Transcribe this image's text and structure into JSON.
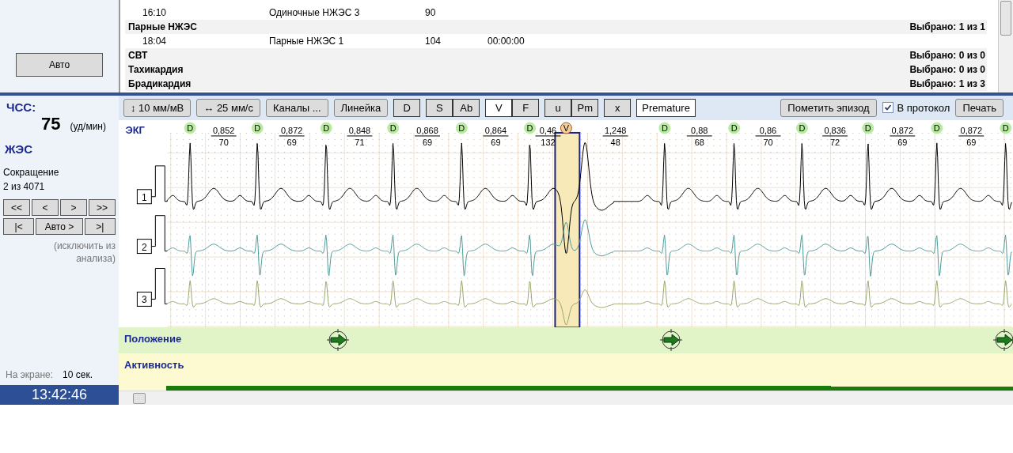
{
  "event_list": {
    "rows": [
      {
        "kind": "event",
        "time": "16:10",
        "name": "Одиночные НЖЭС 3",
        "value": "90"
      },
      {
        "kind": "group",
        "name": "Парные НЖЭС",
        "summary": "Выбрано: 1 из 1"
      },
      {
        "kind": "event",
        "time": "18:04",
        "name": "Парные НЖЭС 1",
        "value": "104",
        "duration": "00:00:00"
      },
      {
        "kind": "group",
        "name": "СВТ",
        "summary": "Выбрано: 0 из 0"
      },
      {
        "kind": "group",
        "name": "Тахикардия",
        "summary": "Выбрано: 0 из 0"
      },
      {
        "kind": "group",
        "name": "Брадикардия",
        "summary": "Выбрано: 1 из 3"
      }
    ]
  },
  "auto_button": "Авто",
  "side_panel": {
    "hr_label": "ЧСС:",
    "hr_value": "75",
    "hr_unit": "(уд/мин)",
    "beat_class": "ЖЭС",
    "beat_label": "Сокращение",
    "beat_position": "2 из 4071",
    "nav_rows": [
      [
        "<<",
        "<",
        ">",
        ">>"
      ],
      [
        "|<",
        "Авто >",
        ">|"
      ]
    ],
    "exclude_note": "(исключить из анализа)",
    "screen_label": "На экране:",
    "screen_value": "10 сек.",
    "clock": "13:42:46"
  },
  "toolbar": {
    "left_buttons": [
      "↕ 10 мм/мВ",
      "↔ 25 мм/с",
      "Каналы ...",
      "Линейка"
    ],
    "toggle_groups": [
      [
        {
          "label": "D",
          "selected": false
        }
      ],
      [
        {
          "label": "S",
          "selected": false
        },
        {
          "label": "Ab",
          "selected": false
        }
      ],
      [
        {
          "label": "V",
          "selected": true
        },
        {
          "label": "F",
          "selected": false
        }
      ],
      [
        {
          "label": "u",
          "selected": false
        },
        {
          "label": "Pm",
          "selected": false
        }
      ],
      [
        {
          "label": "x",
          "selected": false
        }
      ],
      [
        {
          "label": "Premature",
          "selected": true
        }
      ]
    ],
    "mark_button": "Пометить эпизод",
    "protocol": {
      "label": "В протокол",
      "checked": true
    },
    "print_button": "Печать"
  },
  "ecg": {
    "label": "ЭКГ",
    "channels": [
      {
        "number": "1",
        "color": "#000000"
      },
      {
        "number": "2",
        "color": "#4f9c9c"
      },
      {
        "number": "3",
        "color": "#98a86c"
      }
    ],
    "beats": [
      {
        "kind": "normal",
        "label": "D",
        "selected": false
      },
      {
        "kind": "normal",
        "label": "D",
        "rr": "0,852",
        "hr": "70",
        "selected": false
      },
      {
        "kind": "normal",
        "label": "D",
        "rr": "0,872",
        "hr": "69",
        "selected": false
      },
      {
        "kind": "normal",
        "label": "D",
        "rr": "0,848",
        "hr": "71",
        "selected": false
      },
      {
        "kind": "normal",
        "label": "D",
        "rr": "0,868",
        "hr": "69",
        "selected": false
      },
      {
        "kind": "normal",
        "label": "D",
        "rr": "0,864",
        "hr": "69",
        "selected": false
      },
      {
        "kind": "ventricular",
        "label": "V",
        "rr": "0,46",
        "hr": "132",
        "selected": true
      },
      {
        "kind": "normal",
        "label": "D",
        "rr": "1,248",
        "hr": "48",
        "selected": false
      },
      {
        "kind": "normal",
        "label": "D",
        "rr": "0,88",
        "hr": "68",
        "selected": false
      },
      {
        "kind": "normal",
        "label": "D",
        "rr": "0,86",
        "hr": "70",
        "selected": false
      },
      {
        "kind": "normal",
        "label": "D",
        "rr": "0,836",
        "hr": "72",
        "selected": false
      },
      {
        "kind": "normal",
        "label": "D",
        "rr": "0,872",
        "hr": "69",
        "selected": false
      },
      {
        "kind": "normal",
        "label": "D",
        "rr": "0,872",
        "hr": "69",
        "selected": false
      }
    ]
  },
  "position_band": {
    "label": "Положение"
  },
  "activity_band": {
    "label": "Активность"
  }
}
